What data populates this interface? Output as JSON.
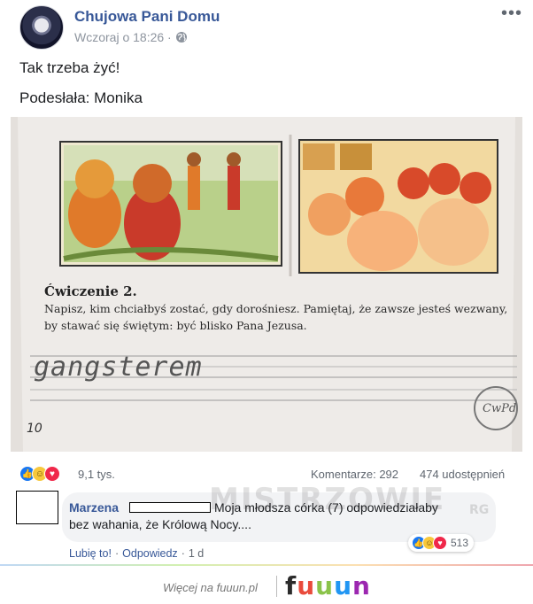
{
  "post": {
    "author": "Chujowa Pani Domu",
    "time": "Wczoraj o 18:26 ·",
    "more": "•••",
    "text_line1": "Tak trzeba żyć!",
    "text_line2": "Podesłała: Monika"
  },
  "photo": {
    "exercise_title": "Ćwiczenie 2.",
    "exercise_text": "Napisz, kim chciałbyś zostać, gdy dorośniesz. Pamiętaj, że zawsze jesteś wezwany, by stawać się świętym: być blisko Pana Jezusa.",
    "handwritten_answer": "gangsterem",
    "page_number": "10",
    "stamp_text": "CwPd"
  },
  "stats": {
    "reactions": "9,1 tys.",
    "comments": "Komentarze: 292",
    "shares": "474 udostępnień"
  },
  "comment": {
    "author": "Marzena",
    "text_line1": "Moja młodsza córka (7) odpowiedziałaby",
    "text_line2": "bez wahania, że Królową Nocy....",
    "reaction_count": "513",
    "like_label": "Lubię to!",
    "reply_label": "Odpowiedz",
    "age": "1 d"
  },
  "watermark": {
    "text": "MISTRZOWIE",
    "tld": "RG"
  },
  "footer": {
    "text": "Więcej na fuuun.pl",
    "brand": [
      "f",
      "u",
      "u",
      "u",
      "n"
    ]
  },
  "colors": {
    "link": "#385898",
    "like": "#1877f2",
    "haha": "#f7c83c",
    "love": "#f0284a"
  },
  "icons": {
    "globe": "globe-icon",
    "more": "more-options-icon",
    "like": "like-reaction-icon",
    "haha": "haha-reaction-icon",
    "love": "love-reaction-icon"
  }
}
